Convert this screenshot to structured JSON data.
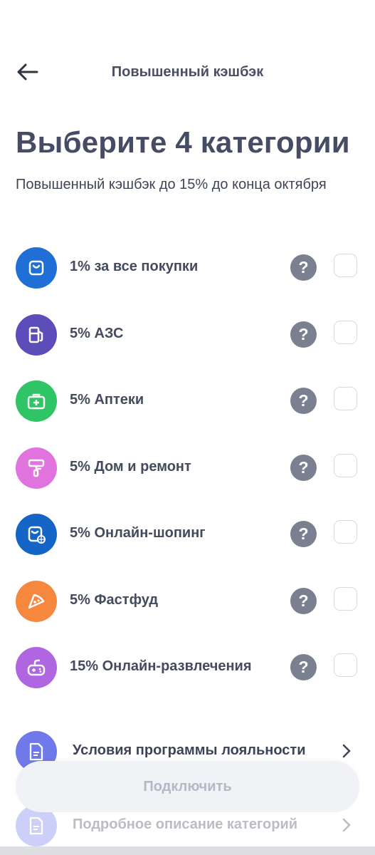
{
  "header": {
    "title": "Повышенный кэшбэк",
    "back_icon": "arrow-left-icon"
  },
  "title": "Выберите 4 категории",
  "subtitle": "Повышенный кэшбэк до 15% до конца октября",
  "categories": [
    {
      "label": "1% за все покупки",
      "icon": "shopping-bag-icon",
      "color": "#1f6fd6",
      "checked": false
    },
    {
      "label": "5% АЗС",
      "icon": "fuel-pump-icon",
      "color": "#5c4dba",
      "checked": false
    },
    {
      "label": "5% Аптеки",
      "icon": "first-aid-kit-icon",
      "color": "#2fc465",
      "checked": false
    },
    {
      "label": "5% Дом и ремонт",
      "icon": "paint-roller-icon",
      "color": "#e073dd",
      "checked": false
    },
    {
      "label": "5% Онлайн-шопинг",
      "icon": "online-shopping-icon",
      "color": "#1565c6",
      "checked": false
    },
    {
      "label": "5% Фастфуд",
      "icon": "pizza-slice-icon",
      "color": "#f5873e",
      "checked": false
    },
    {
      "label": "15% Онлайн-развлечения",
      "icon": "gamepad-icon",
      "color": "#b066e0",
      "checked": false
    }
  ],
  "help_symbol": "?",
  "links": [
    {
      "label": "Условия программы лояльности",
      "icon": "document-icon"
    },
    {
      "label": "Подробное описание категорий",
      "icon": "document-icon"
    }
  ],
  "cta": {
    "label": "Подключить",
    "enabled": false
  }
}
